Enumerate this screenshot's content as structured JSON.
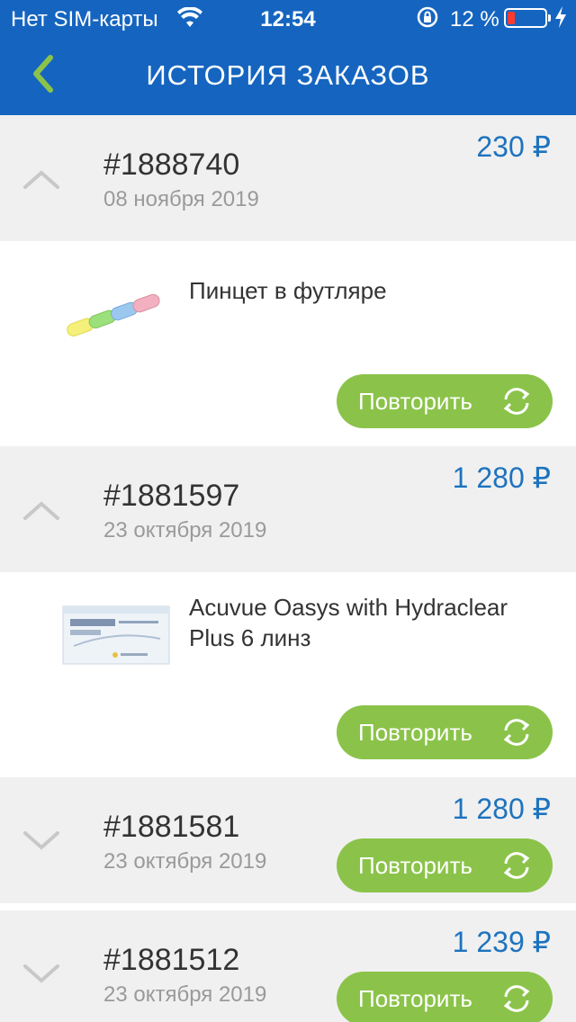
{
  "status": {
    "carrier": "Нет SIM-карты",
    "time": "12:54",
    "battery": "12 %"
  },
  "header": {
    "title": "ИСТОРИЯ ЗАКАЗОВ"
  },
  "colors": {
    "header": "#1565c0",
    "price": "#1e73be",
    "button": "#8bc34a",
    "back_arrow": "#8bc34a"
  },
  "orders": [
    {
      "number": "#1888740",
      "date": "08 ноября 2019",
      "price": "230 ₽",
      "expanded": true,
      "items": [
        {
          "name": "Пинцет в футляре",
          "icon": "tweezers-case-thumbnail"
        }
      ],
      "repeat_label": "Повторить"
    },
    {
      "number": "#1881597",
      "date": "23 октября 2019",
      "price": "1 280 ₽",
      "expanded": true,
      "items": [
        {
          "name": "Acuvue Oasys with Hydraclear Plus 6 линз",
          "icon": "acuvue-box-thumbnail"
        }
      ],
      "repeat_label": "Повторить"
    },
    {
      "number": "#1881581",
      "date": "23 октября 2019",
      "price": "1 280 ₽",
      "expanded": false,
      "repeat_label": "Повторить"
    },
    {
      "number": "#1881512",
      "date": "23 октября 2019",
      "price": "1 239 ₽",
      "expanded": false,
      "repeat_label": "Повторить"
    }
  ]
}
